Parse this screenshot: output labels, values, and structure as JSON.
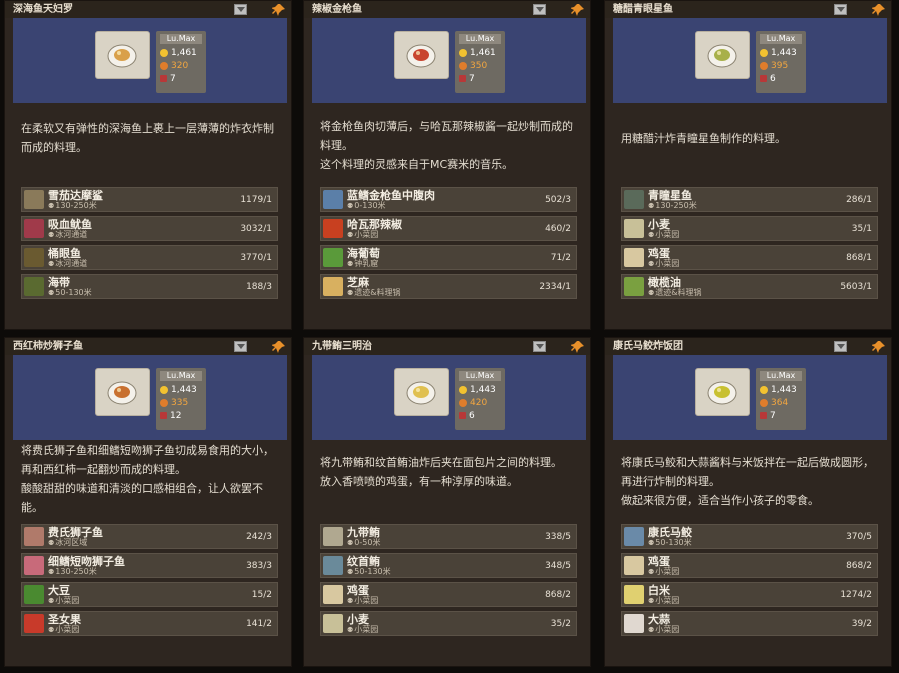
{
  "cards": [
    {
      "title": "深海鱼天妇罗",
      "level": "Lu.Max",
      "price": "1,461",
      "fans": "320",
      "hearts": "7",
      "dish_color": "#d9a04a",
      "desc": [
        "在柔软又有弹性的深海鱼上裹上一层薄薄的炸衣炸制而成的料理。"
      ],
      "ingredients": [
        {
          "name": "雪茄达摩鲨",
          "loc": "130-250米",
          "count": "1179/1",
          "icon": "shark-icon",
          "color": "#8a7a5a"
        },
        {
          "name": "吸血鱿鱼",
          "loc": "冰河通道",
          "count": "3032/1",
          "icon": "squid-icon",
          "color": "#a03a4a"
        },
        {
          "name": "桶眼鱼",
          "loc": "冰河通道",
          "count": "3770/1",
          "icon": "barreleye-icon",
          "color": "#6a5a30"
        },
        {
          "name": "海带",
          "loc": "50-130米",
          "count": "188/3",
          "icon": "kelp-icon",
          "color": "#5a6a30"
        }
      ]
    },
    {
      "title": "辣椒金枪鱼",
      "level": "Lu.Max",
      "price": "1,461",
      "fans": "350",
      "hearts": "7",
      "dish_color": "#c8452f",
      "desc": [
        "将金枪鱼肉切薄后，与哈瓦那辣椒酱一起炒制而成的料理。",
        "这个料理的灵感来自于MC赛米的音乐。"
      ],
      "ingredients": [
        {
          "name": "蓝鳍金枪鱼中腹肉",
          "loc": "0-130米",
          "count": "502/3",
          "icon": "tuna-icon",
          "color": "#5b7fa8"
        },
        {
          "name": "哈瓦那辣椒",
          "loc": "小菜园",
          "count": "460/2",
          "icon": "pepper-icon",
          "color": "#c84020"
        },
        {
          "name": "海葡萄",
          "loc": "钟乳窟",
          "count": "71/2",
          "icon": "sea-grape-icon",
          "color": "#5a9a3a"
        },
        {
          "name": "芝麻",
          "loc": "遗迹&料理锅",
          "count": "2334/1",
          "icon": "sesame-icon",
          "color": "#d8b060"
        }
      ]
    },
    {
      "title": "糖醋青眼星鱼",
      "level": "Lu.Max",
      "price": "1,443",
      "fans": "395",
      "hearts": "6",
      "dish_color": "#a8b04a",
      "desc": [
        "用糖醋汁炸青瞳星鱼制作的料理。"
      ],
      "ingredients": [
        {
          "name": "青瞳星鱼",
          "loc": "130-250米",
          "count": "286/1",
          "icon": "greeneye-icon",
          "color": "#5a6a5a"
        },
        {
          "name": "小麦",
          "loc": "小菜园",
          "count": "35/1",
          "icon": "wheat-icon",
          "color": "#c8c098"
        },
        {
          "name": "鸡蛋",
          "loc": "小菜园",
          "count": "868/1",
          "icon": "egg-icon",
          "color": "#d8c8a0"
        },
        {
          "name": "橄榄油",
          "loc": "遗迹&料理锅",
          "count": "5603/1",
          "icon": "olive-oil-icon",
          "color": "#7aa040"
        }
      ]
    },
    {
      "title": "西红柿炒狮子鱼",
      "level": "Lu.Max",
      "price": "1,443",
      "fans": "335",
      "hearts": "12",
      "dish_color": "#c8702f",
      "desc": [
        "将费氏狮子鱼和细鳍短吻狮子鱼切成易食用的大小，再和西红柿一起翻炒而成的料理。",
        "酸酸甜甜的味道和清淡的口感相组合，让人欲罢不能。"
      ],
      "ingredients": [
        {
          "name": "费氏狮子鱼",
          "loc": "冰河区域",
          "count": "242/3",
          "icon": "lionfish-icon",
          "color": "#b07a6a"
        },
        {
          "name": "细鳍短吻狮子鱼",
          "loc": "130-250米",
          "count": "383/3",
          "icon": "lionfish2-icon",
          "color": "#c86a7a"
        },
        {
          "name": "大豆",
          "loc": "小菜园",
          "count": "15/2",
          "icon": "soybean-icon",
          "color": "#4a8a30"
        },
        {
          "name": "圣女果",
          "loc": "小菜园",
          "count": "141/2",
          "icon": "tomato-icon",
          "color": "#c83a2a"
        }
      ]
    },
    {
      "title": "九带鲔三明治",
      "level": "Lu.Max",
      "price": "1,443",
      "fans": "420",
      "hearts": "6",
      "dish_color": "#e0c050",
      "desc": [
        "将九带鲔和纹首鲔油炸后夹在面包片之间的料理。",
        "放入香喷喷的鸡蛋，有一种淳厚的味道。"
      ],
      "ingredients": [
        {
          "name": "九带鲔",
          "loc": "0-50米",
          "count": "338/5",
          "icon": "ninebanded-icon",
          "color": "#b0a890"
        },
        {
          "name": "纹首鲔",
          "loc": "50-130米",
          "count": "348/5",
          "icon": "striped-icon",
          "color": "#6a8a9a"
        },
        {
          "name": "鸡蛋",
          "loc": "小菜园",
          "count": "868/2",
          "icon": "egg-icon",
          "color": "#d8c8a0"
        },
        {
          "name": "小麦",
          "loc": "小菜园",
          "count": "35/2",
          "icon": "wheat-icon",
          "color": "#c8c098"
        }
      ]
    },
    {
      "title": "康氏马鲛炸饭团",
      "level": "Lu.Max",
      "price": "1,443",
      "fans": "364",
      "hearts": "7",
      "dish_color": "#c8c030",
      "desc": [
        "将康氏马鲛和大蒜酱料与米饭拌在一起后做成圆形，再进行炸制的料理。",
        "做起来很方便，适合当作小孩子的零食。"
      ],
      "ingredients": [
        {
          "name": "康氏马鲛",
          "loc": "50-130米",
          "count": "370/5",
          "icon": "mackerel-icon",
          "color": "#6a8aa8"
        },
        {
          "name": "鸡蛋",
          "loc": "小菜园",
          "count": "868/2",
          "icon": "egg-icon",
          "color": "#d8c8a0"
        },
        {
          "name": "白米",
          "loc": "小菜园",
          "count": "1274/2",
          "icon": "rice-icon",
          "color": "#e0d070"
        },
        {
          "name": "大蒜",
          "loc": "小菜园",
          "count": "39/2",
          "icon": "garlic-icon",
          "color": "#e0d8d0"
        }
      ]
    }
  ]
}
